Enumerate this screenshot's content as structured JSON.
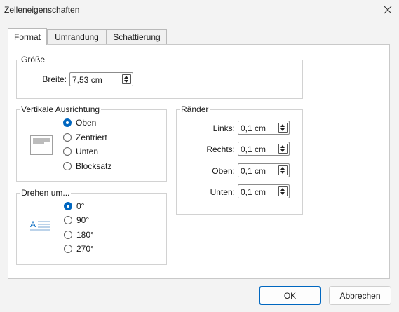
{
  "window": {
    "title": "Zelleneigenschaften",
    "close_icon": "close-icon"
  },
  "tabs": [
    {
      "label": "Format",
      "active": true
    },
    {
      "label": "Umrandung",
      "active": false
    },
    {
      "label": "Schattierung",
      "active": false
    }
  ],
  "size_group": {
    "legend": "Größe",
    "width_label": "Breite:",
    "width_value": "7,53 cm"
  },
  "vertical_alignment": {
    "legend": "Vertikale Ausrichtung",
    "preview_icon": "text-align-top-preview-icon",
    "options": [
      {
        "label": "Oben",
        "checked": true
      },
      {
        "label": "Zentriert",
        "checked": false
      },
      {
        "label": "Unten",
        "checked": false
      },
      {
        "label": "Blocksatz",
        "checked": false
      }
    ]
  },
  "rotate": {
    "legend": "Drehen um...",
    "preview_icon": "text-rotation-preview-icon",
    "preview_letter": "A",
    "options": [
      {
        "label": "0°",
        "checked": true
      },
      {
        "label": "90°",
        "checked": false
      },
      {
        "label": "180°",
        "checked": false
      },
      {
        "label": "270°",
        "checked": false
      }
    ]
  },
  "margins": {
    "legend": "Ränder",
    "fields": [
      {
        "label": "Links:",
        "value": "0,1 cm"
      },
      {
        "label": "Rechts:",
        "value": "0,1 cm"
      },
      {
        "label": "Oben:",
        "value": "0,1 cm"
      },
      {
        "label": "Unten:",
        "value": "0,1 cm"
      }
    ]
  },
  "buttons": {
    "ok": "OK",
    "cancel": "Abbrechen"
  },
  "colors": {
    "accent": "#0067c0"
  }
}
